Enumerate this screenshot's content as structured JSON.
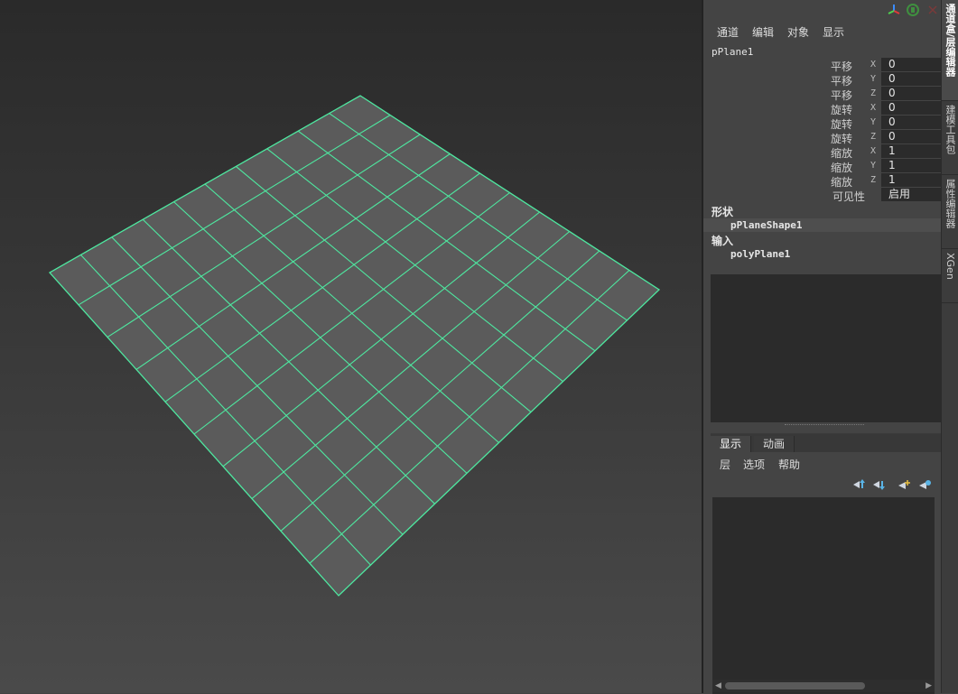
{
  "menu": [
    "通道",
    "编辑",
    "对象",
    "显示"
  ],
  "object_name": "pPlane1",
  "attributes": [
    {
      "label": "平移",
      "axis": "X",
      "value": "0"
    },
    {
      "label": "平移",
      "axis": "Y",
      "value": "0"
    },
    {
      "label": "平移",
      "axis": "Z",
      "value": "0"
    },
    {
      "label": "旋转",
      "axis": "X",
      "value": "0"
    },
    {
      "label": "旋转",
      "axis": "Y",
      "value": "0"
    },
    {
      "label": "旋转",
      "axis": "Z",
      "value": "0"
    },
    {
      "label": "缩放",
      "axis": "X",
      "value": "1"
    },
    {
      "label": "缩放",
      "axis": "Y",
      "value": "1"
    },
    {
      "label": "缩放",
      "axis": "Z",
      "value": "1"
    },
    {
      "label": "可见性",
      "axis": "",
      "value": "启用"
    }
  ],
  "shape_section": {
    "title": "形状",
    "item": "pPlaneShape1"
  },
  "input_section": {
    "title": "输入",
    "item": "polyPlane1"
  },
  "layer_tabs": [
    "显示",
    "动画"
  ],
  "layer_menu": [
    "层",
    "选项",
    "帮助"
  ],
  "side_tabs": [
    "通道盒/层编辑器",
    "建模工具包",
    "属性编辑器",
    "XGen"
  ],
  "colors": {
    "wireframe": "#4ee8a0",
    "plane_fill": "#5b5b5b"
  },
  "icons": [
    "axis-icon",
    "channel-settings-icon",
    "layer-move-up-icon",
    "layer-move-down-icon",
    "new-layer-icon",
    "new-layer-selected-icon"
  ]
}
